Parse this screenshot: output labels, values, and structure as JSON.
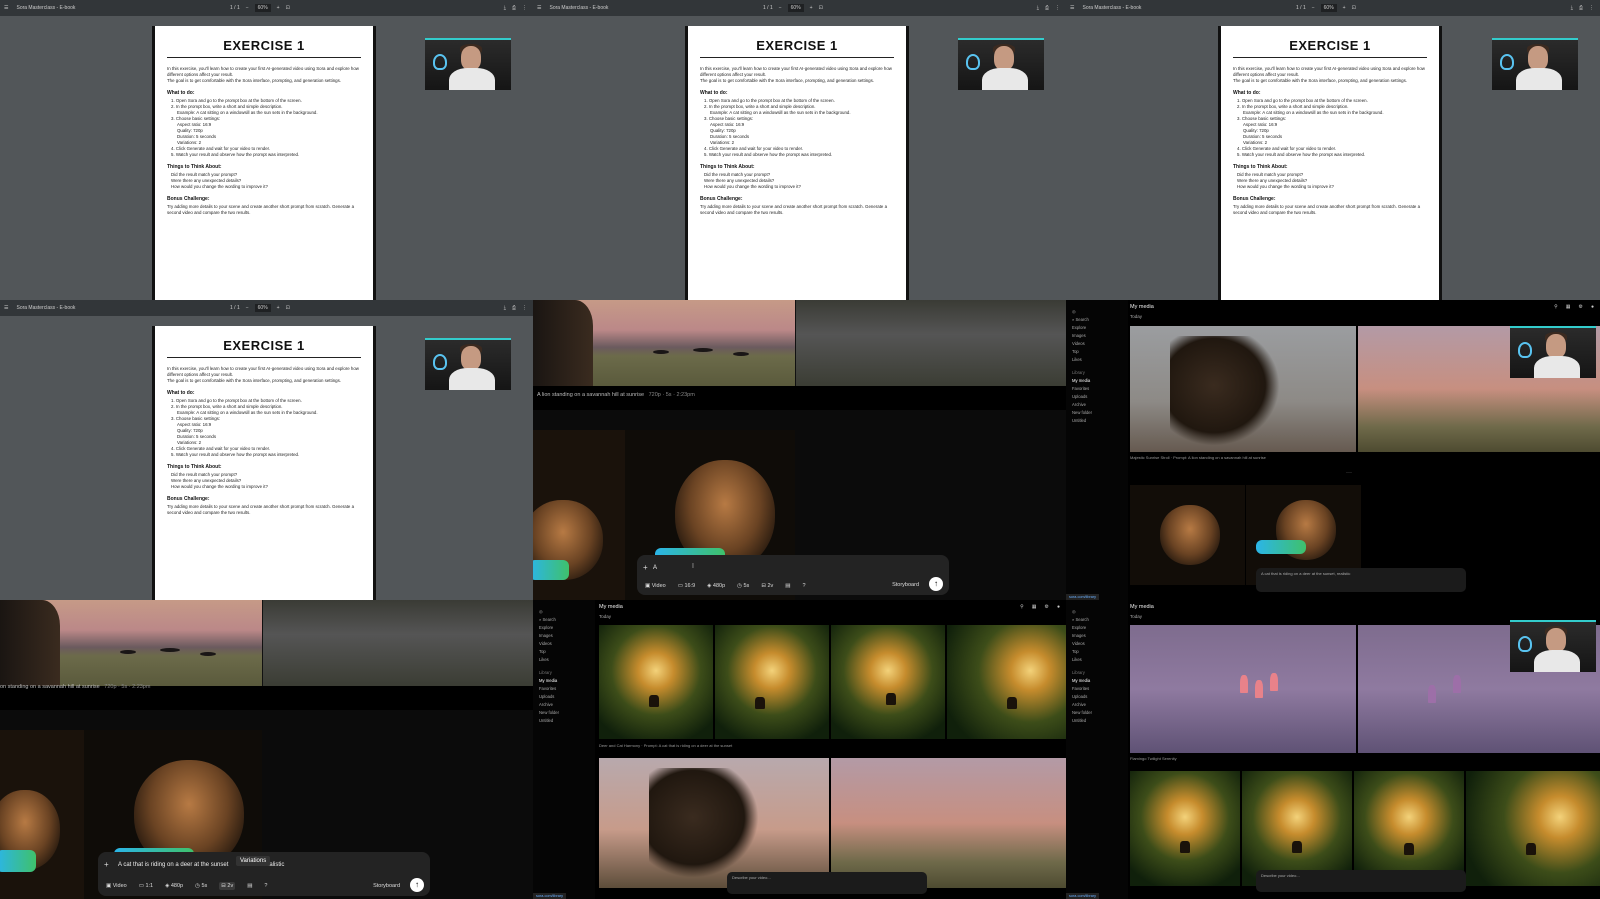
{
  "pdf": {
    "window_title": "Sora Masterclass - E-book",
    "zoom": "60%",
    "page_title": "EXERCISE 1",
    "intro": "In this exercise, you'll learn how to create your first AI-generated video using Sora and explore how different options affect your result.",
    "intro2": "The goal is to get comfortable with the Sora interface, prompting, and generation settings.",
    "what_to_do": "What to do:",
    "steps": [
      "1. Open Sora and go to the prompt box at the bottom of the screen.",
      "2. In the prompt box, write a short and simple description.",
      "Example: A cat sitting on a windowsill as the sun sets in the background.",
      "3. Choose basic settings:",
      "Aspect ratio: 16:9",
      "Quality: 720p",
      "Duration: 5 seconds",
      "Variations: 2",
      "4. Click Generate and wait for your video to render.",
      "5. Watch your result and observe how the prompt was interpreted."
    ],
    "think_title": "Things to Think About:",
    "think": [
      "Did the result match your prompt?",
      "Were there any unexpected details?",
      "How would you change the wording to improve it?"
    ],
    "bonus_title": "Bonus Challenge:",
    "bonus": "Try adding more details to your scene and create another short prompt from scratch. Generate a second video and compare the two results."
  },
  "savannah": {
    "caption": "A lion standing on a savannah hill at sunrise",
    "caption_meta": "720p · 5s · 2:23pm",
    "caption_cut": "on standing on a savannah hill at sunrise",
    "prompt_partial": "A",
    "prompt_full": "A cat that is riding on a deer at the sunset",
    "prompt_tail": "ealistic",
    "tooltip": "Variations",
    "tools": {
      "type": "Video",
      "ratio": "16:9",
      "ratio_alt": "1:1",
      "quality": "480p",
      "duration": "5s",
      "variations": "2v",
      "help": "?"
    },
    "storyboard": "Storyboard"
  },
  "sora": {
    "header": "My media",
    "today": "Today",
    "search": "Search",
    "nav": [
      "Explore",
      "Images",
      "Videos",
      "Top",
      "Likes"
    ],
    "library_label": "Library",
    "library": [
      "My media",
      "Favorites",
      "Uploads",
      "Archive"
    ],
    "new_folder": "New folder",
    "folder": "Untitled",
    "lion_caption": "Majestic Sunrise Stroll",
    "lion_prompt": "Prompt: A lion standing on a savannah hill at sunrise",
    "deer_caption": "Deer and Cat Harmony",
    "deer_prompt": "Prompt: A cat that is riding on a deer at the sunset",
    "flamingo_caption": "Flamingo Twilight Serenity",
    "mini_prompt_cat": "A cat that is riding on a deer at the sunset, realistic",
    "describe": "Describe your video...",
    "storyboard": "Storyboard"
  }
}
